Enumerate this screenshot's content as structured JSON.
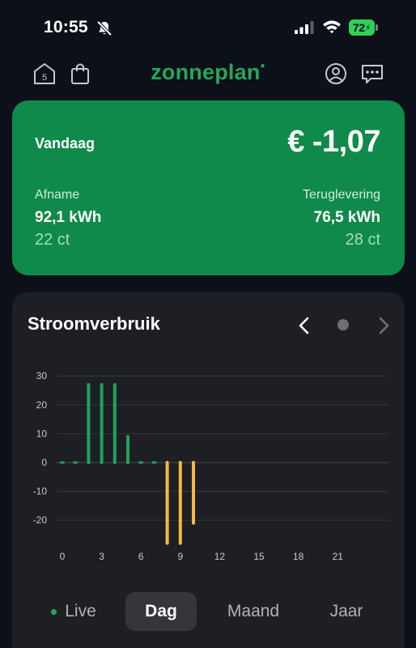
{
  "status_bar": {
    "time": "10:55",
    "battery": "72"
  },
  "header": {
    "logo": "zonneplan",
    "house_badge": "5",
    "icons": [
      "house-icon",
      "shopping-bag-icon",
      "profile-icon",
      "chat-icon"
    ]
  },
  "summary": {
    "title": "Vandaag",
    "amount": "€ -1,07",
    "left": {
      "label": "Afname",
      "value": "92,1 kWh",
      "price": "22 ct"
    },
    "right": {
      "label": "Teruglevering",
      "value": "76,5 kWh",
      "price": "28 ct"
    },
    "color": "#108a4a"
  },
  "chart_card": {
    "title": "Stroomverbruik"
  },
  "chart_data": {
    "type": "bar",
    "x": [
      0,
      1,
      2,
      3,
      4,
      5,
      6,
      7,
      8,
      9,
      10
    ],
    "values": [
      0,
      0,
      27,
      27,
      27,
      9,
      0,
      0,
      -28,
      -28,
      -21
    ],
    "x_ticks": [
      0,
      3,
      6,
      9,
      12,
      15,
      18,
      21
    ],
    "y_ticks": [
      30,
      20,
      10,
      0,
      -10,
      -20
    ],
    "ylim": [
      -30,
      30
    ],
    "xlim": [
      0,
      23
    ],
    "grid": true,
    "positive_color": "#1fa25a",
    "negative_color": "#f4b942"
  },
  "tabs": [
    {
      "label": "Live",
      "active": false
    },
    {
      "label": "Dag",
      "active": true
    },
    {
      "label": "Maand",
      "active": false
    },
    {
      "label": "Jaar",
      "active": false
    }
  ]
}
